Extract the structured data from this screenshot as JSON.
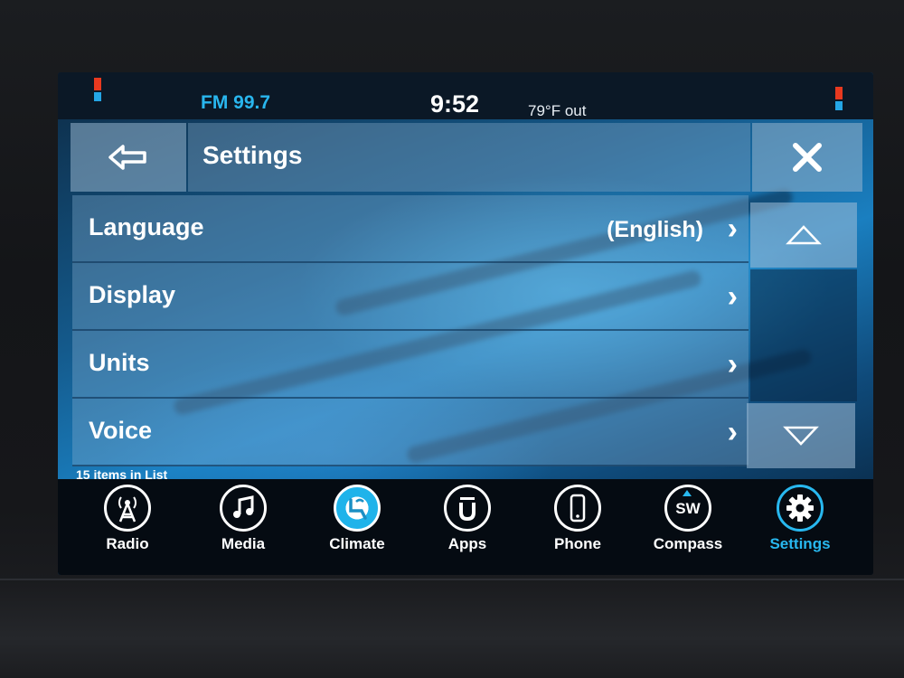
{
  "status": {
    "station": "FM 99.7",
    "time": "9:52",
    "outside_temp": "79°F out"
  },
  "header": {
    "title": "Settings",
    "back_icon": "back-arrow-icon",
    "close_icon": "close-icon"
  },
  "list": {
    "items": [
      {
        "label": "Language",
        "value": "(English)"
      },
      {
        "label": "Display",
        "value": ""
      },
      {
        "label": "Units",
        "value": ""
      },
      {
        "label": "Voice",
        "value": ""
      }
    ],
    "count_text": "15 items in List"
  },
  "nav": {
    "items": [
      {
        "label": "Radio",
        "icon": "radio-tower-icon"
      },
      {
        "label": "Media",
        "icon": "music-note-icon"
      },
      {
        "label": "Climate",
        "icon": "climate-seat-icon"
      },
      {
        "label": "Apps",
        "icon": "apps-icon"
      },
      {
        "label": "Phone",
        "icon": "phone-icon"
      },
      {
        "label": "Compass",
        "icon": "compass-icon",
        "heading": "SW"
      },
      {
        "label": "Settings",
        "icon": "gear-icon",
        "active": true
      }
    ]
  },
  "colors": {
    "accent": "#28b8ef",
    "signal_red": "#e8391f",
    "signal_blue": "#24a6e6"
  }
}
